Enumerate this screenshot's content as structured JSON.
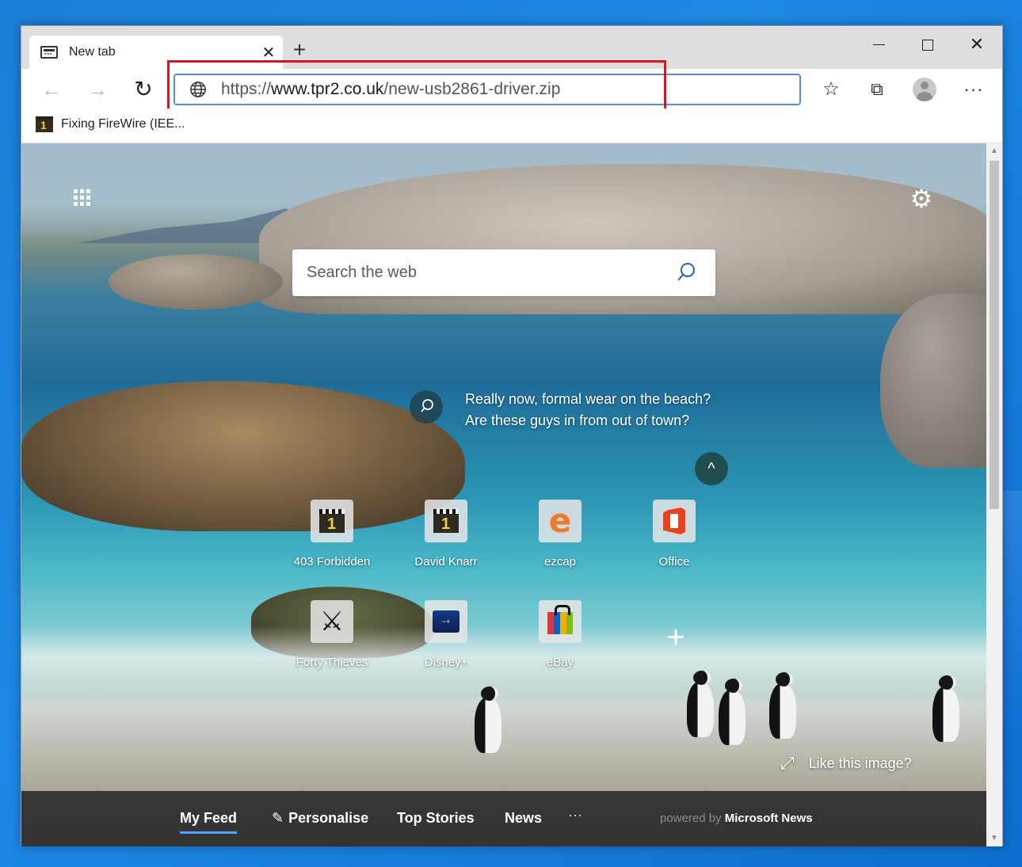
{
  "browser": {
    "tab": {
      "title": "New tab",
      "close_label": "✕"
    },
    "new_tab_label": "+",
    "window_controls": {
      "minimize": "—",
      "maximize": "☐",
      "close": "✕"
    },
    "address": {
      "scheme": "https://",
      "host": "www.tpr2.co.uk",
      "path": "/new-usb2861-driver.zip",
      "highlight_color": "#d7141f"
    },
    "toolbar_icons": [
      "back-icon",
      "forward-icon",
      "refresh-icon",
      "favorites-icon",
      "collections-icon",
      "profile-icon",
      "more-icon"
    ],
    "favorites_bar": {
      "items": [
        {
          "label": "Fixing FireWire (IEE..."
        }
      ]
    }
  },
  "newtab": {
    "search": {
      "placeholder": "Search the web"
    },
    "caption": {
      "line1": "Really now, formal wear on the beach?",
      "line2": "Are these guys in from out of town?"
    },
    "tiles": [
      {
        "label": "403 Forbidden",
        "icon": "clapperboard-icon"
      },
      {
        "label": "David Knarr",
        "icon": "clapperboard-icon"
      },
      {
        "label": "ezcap",
        "icon": "ie-icon"
      },
      {
        "label": "Office",
        "icon": "office-icon"
      },
      {
        "label": "Forty Thieves",
        "icon": "swords-icon"
      },
      {
        "label": "Disney+",
        "icon": "disney-icon"
      },
      {
        "label": "eBay",
        "icon": "ebay-bag-icon"
      }
    ],
    "like_image": "Like this image?",
    "feed": {
      "items": [
        "My Feed",
        "Personalise",
        "Top Stories",
        "News"
      ],
      "more": "···",
      "powered_prefix": "powered by",
      "powered_brand": "Microsoft News"
    }
  }
}
